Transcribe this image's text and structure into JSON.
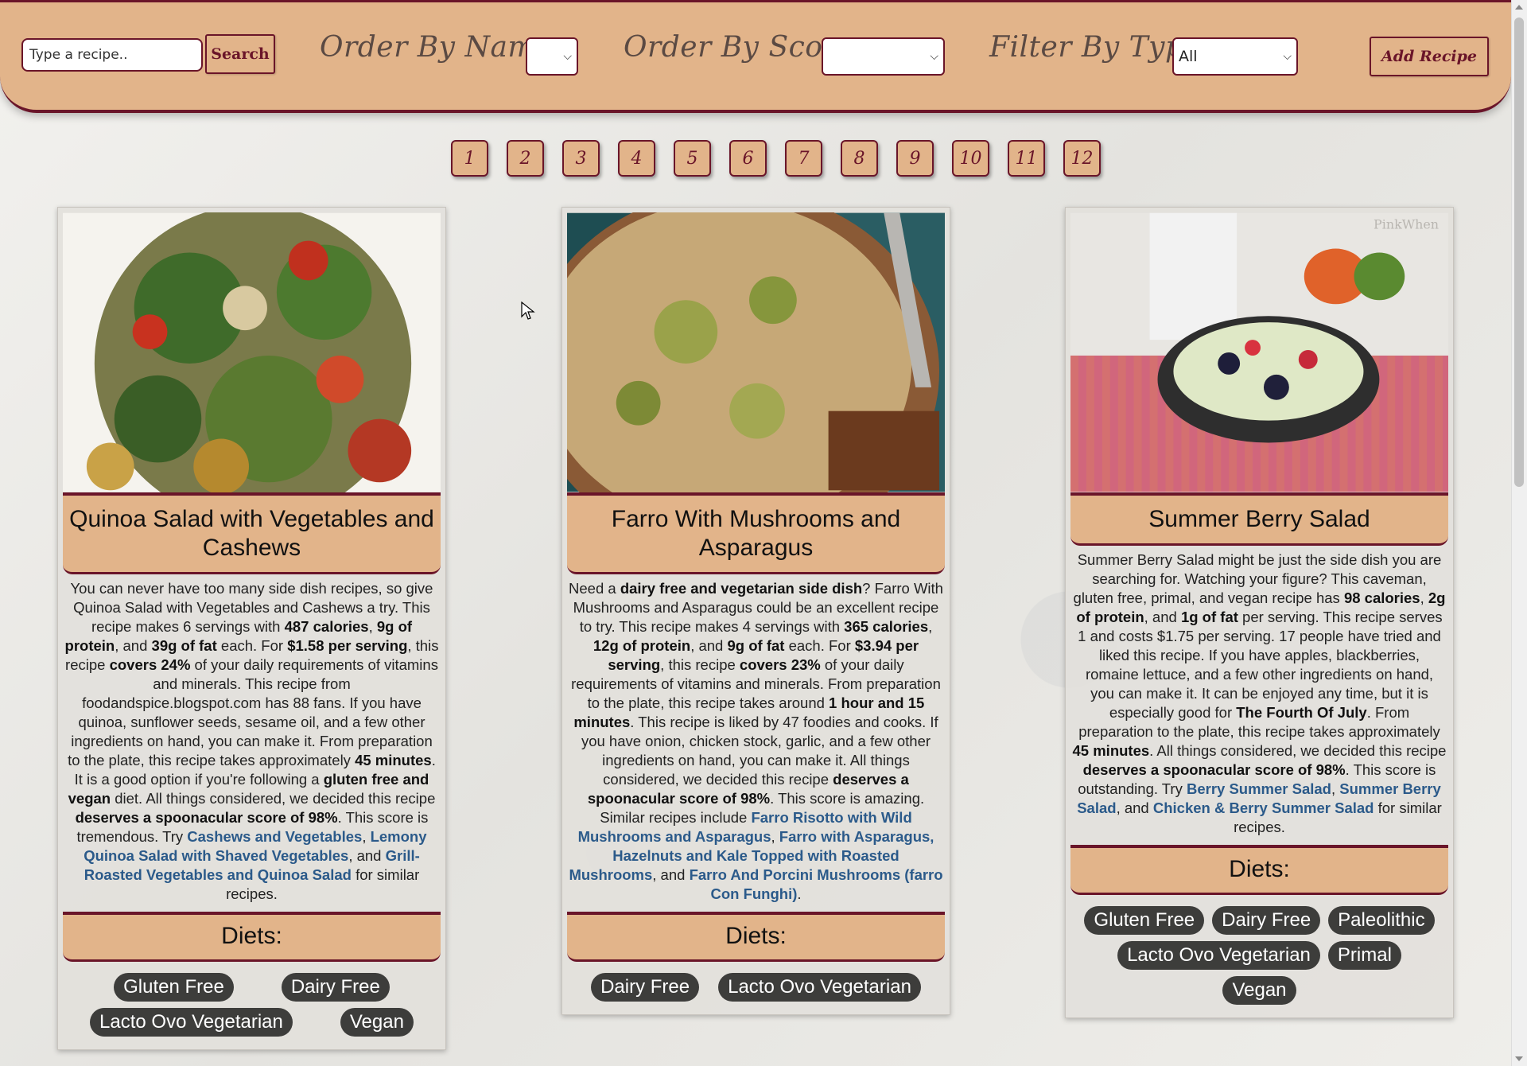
{
  "search": {
    "placeholder": "Type a recipe..",
    "button": "Search"
  },
  "filters": {
    "order_name_label": "Order By Name:",
    "order_name_value": "",
    "order_score_label": "Order By Score:",
    "order_score_value": "",
    "filter_type_label": "Filter By Type:",
    "filter_type_value": "All"
  },
  "add_recipe": "Add Recipe",
  "pages": [
    "1",
    "2",
    "3",
    "4",
    "5",
    "6",
    "7",
    "8",
    "9",
    "10",
    "11",
    "12"
  ],
  "cards": [
    {
      "title": "Quinoa Salad with Vegetables and Cashews",
      "diets_heading": "Diets:",
      "diets": [
        "Gluten Free",
        "Dairy Free",
        "Lacto Ovo Vegetarian",
        "Vegan"
      ]
    },
    {
      "title": "Farro With Mushrooms and Asparagus",
      "diets_heading": "Diets:",
      "diets": [
        "Dairy Free",
        "Lacto Ovo Vegetarian"
      ]
    },
    {
      "title": "Summer Berry Salad",
      "diets_heading": "Diets:",
      "diets": [
        "Gluten Free",
        "Dairy Free",
        "Paleolithic",
        "Lacto Ovo Vegetarian",
        "Primal",
        "Vegan"
      ]
    }
  ],
  "desc": {
    "c0": [
      "You can never have too many side dish recipes, so give Quinoa Salad with Vegetables and Cashews a try. This recipe makes 6 servings with ",
      "487 calories",
      ", ",
      "9g of protein",
      ", and ",
      "39g of fat",
      " each. For ",
      "$1.58 per serving",
      ", this recipe ",
      "covers 24%",
      " of your daily requirements of vitamins and minerals. This recipe from foodandspice.blogspot.com has 88 fans. If you have quinoa, sunflower seeds, sesame oil, and a few other ingredients on hand, you can make it. From preparation to the plate, this recipe takes approximately ",
      "45 minutes",
      ". It is a good option if you're following a ",
      "gluten free and vegan",
      " diet. All things considered, we decided this recipe ",
      "deserves a spoonacular score of 98%",
      ". This score is tremendous. Try ",
      "Cashews and Vegetables",
      ", ",
      "Lemony Quinoa Salad with Shaved Vegetables",
      ", and ",
      "Grill-Roasted Vegetables and Quinoa Salad",
      " for similar recipes."
    ],
    "c1": [
      "Need a ",
      "dairy free and vegetarian side dish",
      "? Farro With Mushrooms and Asparagus could be an excellent recipe to try. This recipe makes 4 servings with ",
      "365 calories",
      ", ",
      "12g of protein",
      ", and ",
      "9g of fat",
      " each. For ",
      "$3.94 per serving",
      ", this recipe ",
      "covers 23%",
      " of your daily requirements of vitamins and minerals. From preparation to the plate, this recipe takes around ",
      "1 hour and 15 minutes",
      ". This recipe is liked by 47 foodies and cooks. If you have onion, chicken stock, garlic, and a few other ingredients on hand, you can make it. All things considered, we decided this recipe ",
      "deserves a spoonacular score of 98%",
      ". This score is amazing. Similar recipes include ",
      "Farro Risotto with Wild Mushrooms and Asparagus",
      ", ",
      "Farro with Asparagus, Hazelnuts and Kale Topped with Roasted Mushrooms",
      ", and ",
      "Farro And Porcini Mushrooms (farro Con Funghi)",
      "."
    ],
    "c2": [
      "Summer Berry Salad might be just the side dish you are searching for. Watching your figure? This caveman, gluten free, primal, and vegan recipe has ",
      "98 calories",
      ", ",
      "2g of protein",
      ", and ",
      "1g of fat",
      " per serving. This recipe serves 1 and costs $1.75 per serving. 17 people have tried and liked this recipe. If you have apples, blackberries, romaine lettuce, and a few other ingredients on hand, you can make it. It can be enjoyed any time, but it is especially good for ",
      "The Fourth Of July",
      ". From preparation to the plate, this recipe takes approximately ",
      "45 minutes",
      ". All things considered, we decided this recipe ",
      "deserves a spoonacular score of 98%",
      ". This score is outstanding. Try ",
      "Berry Summer Salad",
      ", ",
      "Summer Berry Salad",
      ", and ",
      "Chicken & Berry Summer Salad",
      " for similar recipes."
    ]
  },
  "image_credit": "PinkWhen",
  "colors": {
    "accent": "#e2b48a",
    "border": "#6a1529",
    "link": "#2b5a8a",
    "tag": "#3d3d3b"
  }
}
